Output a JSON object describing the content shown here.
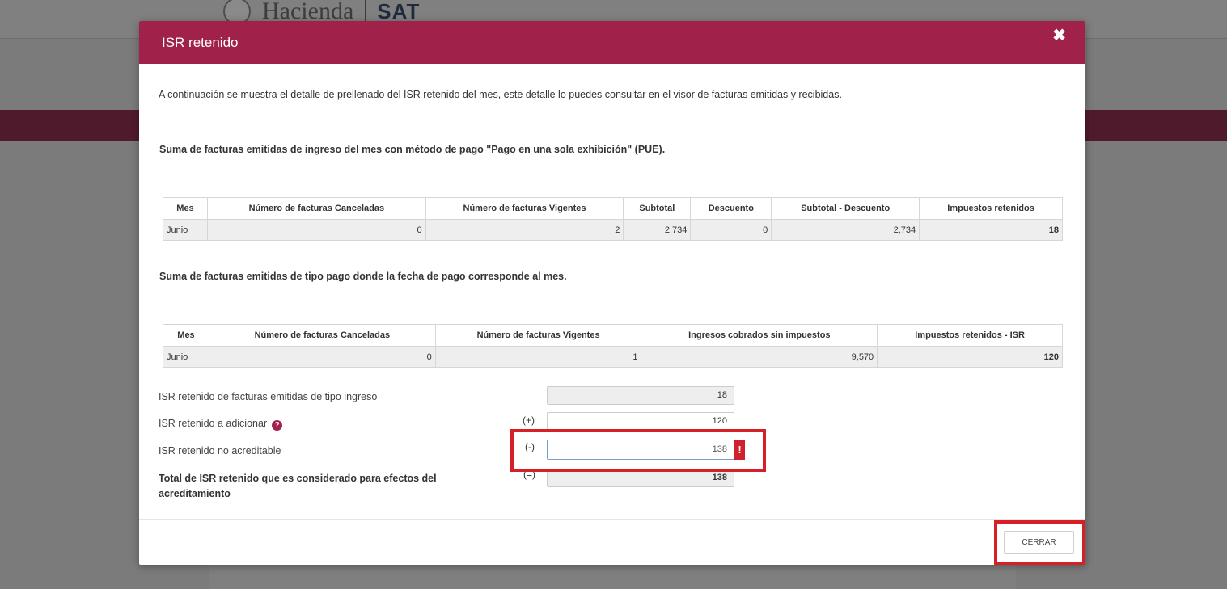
{
  "background": {
    "logo_text": "Hacienda",
    "logo_sat": "SAT"
  },
  "modal": {
    "title": "ISR retenido",
    "close_icon": "✖",
    "intro": "A continuación se muestra el detalle de prellenado del ISR retenido del mes, este detalle lo puedes consultar en el visor de facturas emitidas y recibidas.",
    "section1": {
      "title": "Suma de facturas emitidas de ingreso del mes con método de pago \"Pago en una sola exhibición\" (PUE).",
      "headers": [
        "Mes",
        "Número de facturas Canceladas",
        "Número de facturas Vigentes",
        "Subtotal",
        "Descuento",
        "Subtotal - Descuento",
        "Impuestos retenidos"
      ],
      "row": [
        "Junio",
        "0",
        "2",
        "2,734",
        "0",
        "2,734",
        "18"
      ]
    },
    "section2": {
      "title": "Suma de facturas emitidas de tipo pago donde la fecha de pago corresponde al mes.",
      "headers": [
        "Mes",
        "Número de facturas Canceladas",
        "Número de facturas Vigentes",
        "Ingresos cobrados sin impuestos",
        "Impuestos retenidos - ISR"
      ],
      "row": [
        "Junio",
        "0",
        "1",
        "9,570",
        "120"
      ]
    },
    "form": {
      "row1_label": "ISR retenido de facturas emitidas de tipo ingreso",
      "row1_value": "18",
      "row2_label": "ISR retenido a adicionar",
      "row2_op": "(+)",
      "row2_value": "120",
      "row3_label": "ISR retenido no acreditable",
      "row3_op": "(-)",
      "row3_value": "138",
      "error_mark": "!",
      "total_label": "Total de ISR retenido que es considerado para efectos del acreditamiento",
      "total_op": "(=)",
      "total_value": "138"
    },
    "close_button": "CERRAR"
  },
  "colors": {
    "header_bg": "#a0224a",
    "highlight": "#d61f26",
    "error": "#d0202f"
  }
}
